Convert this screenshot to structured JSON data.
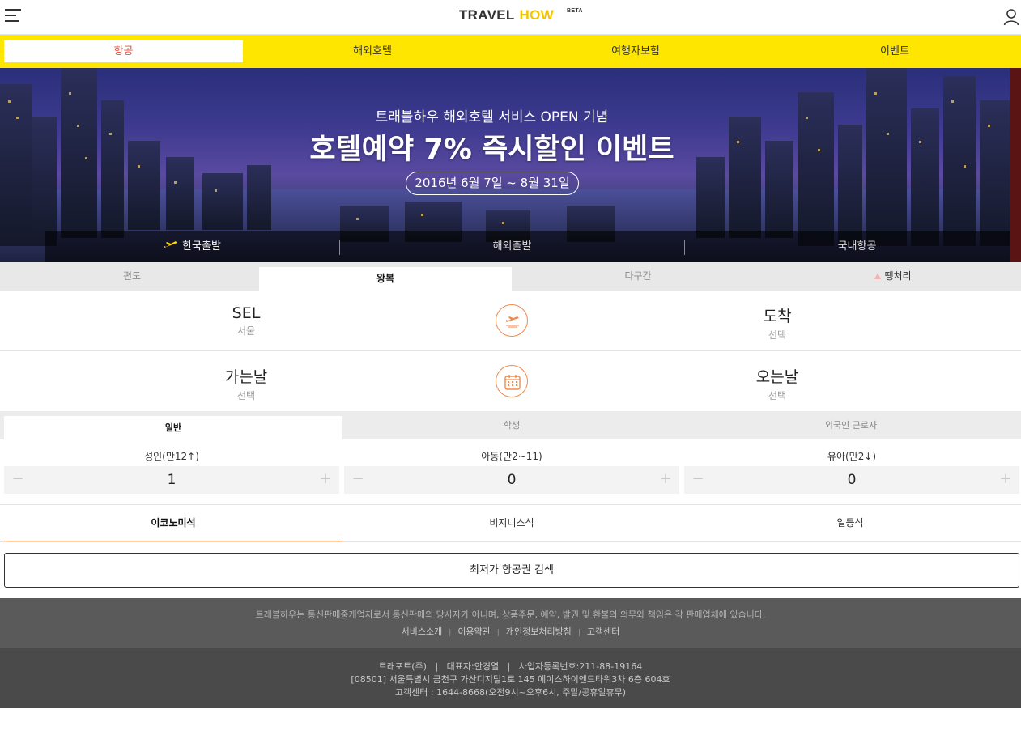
{
  "header": {
    "logo_travel": "TRAVEL",
    "logo_how": "HOW",
    "logo_beta": "BETA"
  },
  "main_tabs": [
    {
      "label": "항공",
      "active": true
    },
    {
      "label": "해외호텔"
    },
    {
      "label": "여행자보험"
    },
    {
      "label": "이벤트"
    }
  ],
  "banner": {
    "subtitle": "트래블하우 해외호텔 서비스 OPEN 기념",
    "title": "호텔예약 7% 즉시할인 이벤트",
    "date": "2016년 6월 7일 ~ 8월 31일"
  },
  "departure_tabs": [
    {
      "label": "한국출발",
      "active": true
    },
    {
      "label": "해외출발"
    },
    {
      "label": "국내항공"
    }
  ],
  "trip_tabs": [
    {
      "label": "편도"
    },
    {
      "label": "왕복",
      "active": true
    },
    {
      "label": "다구간"
    },
    {
      "label": "땡처리"
    }
  ],
  "route": {
    "origin_code": "SEL",
    "origin_name": "서울",
    "dest_label": "도착",
    "dest_sub": "선택"
  },
  "dates": {
    "depart_label": "가는날",
    "depart_sub": "선택",
    "return_label": "오는날",
    "return_sub": "선택"
  },
  "pax_tabs": [
    {
      "label": "일반",
      "active": true
    },
    {
      "label": "학생"
    },
    {
      "label": "외국인 근로자"
    }
  ],
  "passengers": [
    {
      "label": "성인(만12↑)",
      "value": "1"
    },
    {
      "label": "아동(만2~11)",
      "value": "0"
    },
    {
      "label": "유아(만2↓)",
      "value": "0"
    }
  ],
  "stepper_symbols": {
    "minus": "−",
    "plus": "+"
  },
  "seat_classes": [
    {
      "label": "이코노미석",
      "active": true
    },
    {
      "label": "비지니스석"
    },
    {
      "label": "일등석"
    }
  ],
  "search_button": "최저가 항공권 검색",
  "footer": {
    "notice": "트래블하우는 통신판매중개업자로서 통신판매의 당사자가 아니며, 상품주문, 예약, 발권 및 환불의 의무와 책임은 각 판매업체에 있습니다.",
    "links": [
      "서비스소개",
      "이용약관",
      "개인정보처리방침",
      "고객센터"
    ],
    "link_sep": "|",
    "company_line": "트래포트(주)   |   대표자:안경열   |   사업자등록번호:211-88-19164",
    "address_line": "[08501] 서울특별시 금천구 가산디지털1로 145 에이스하이엔드타워3차 6층 604호",
    "cs_line": "고객센터 : 1644-8668(오전9시~오후6시, 주말/공휴일휴무)"
  },
  "colors": {
    "accent_yellow": "#ffe600",
    "accent_red": "#e84c3d",
    "accent_orange": "#f08a4b"
  }
}
